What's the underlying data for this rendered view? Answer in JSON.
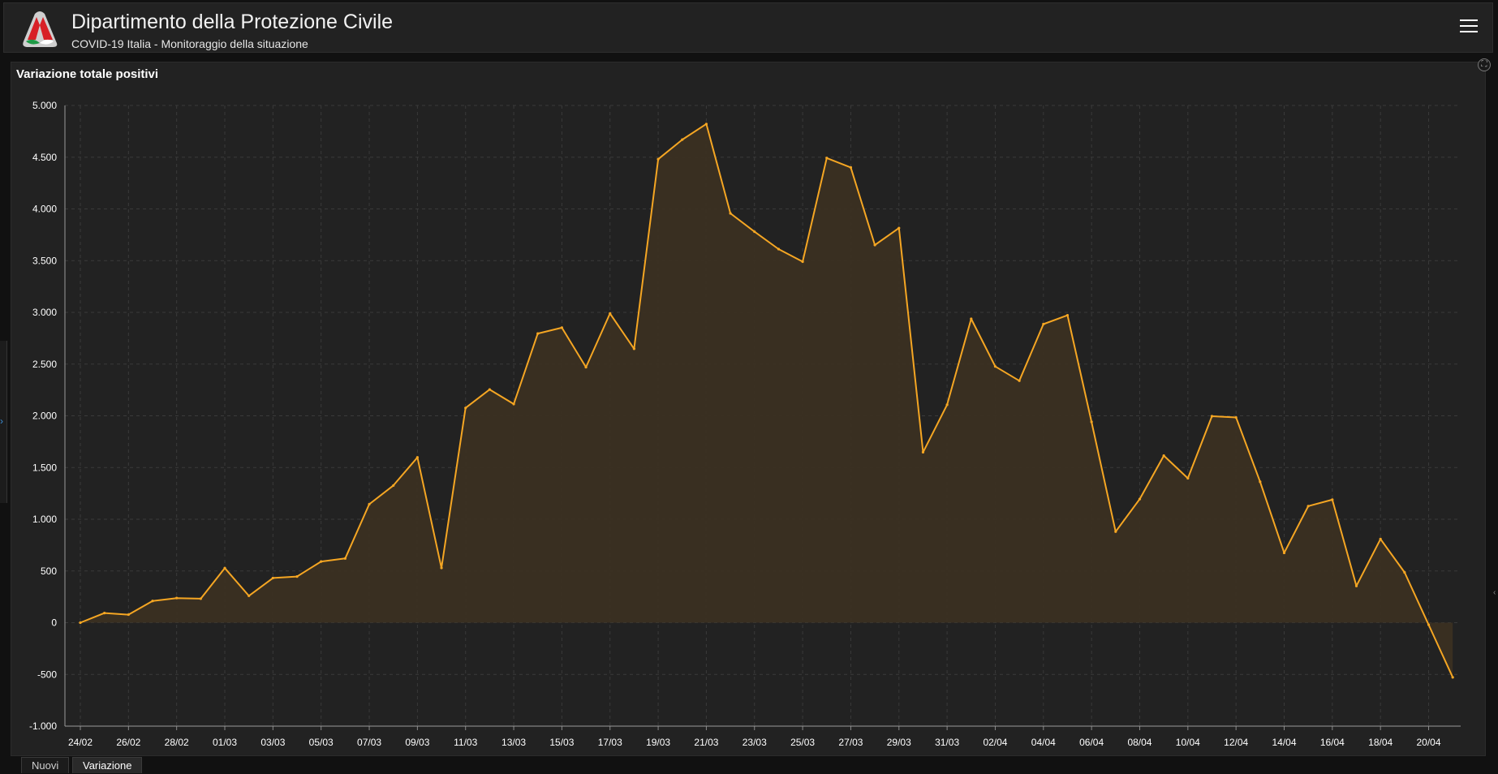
{
  "header": {
    "title": "Dipartimento della Protezione Civile",
    "subtitle": "COVID-19 Italia - Monitoraggio della situazione"
  },
  "panel": {
    "title": "Variazione totale positivi"
  },
  "tabs": [
    "Nuovi",
    "Variazione"
  ],
  "icons": {
    "logo": "protezione-civile-logo",
    "menu": "hamburger-menu-icon",
    "expand": "expand-icon"
  },
  "colors": {
    "line": "#f5a623",
    "area": "#3b3022",
    "background": "#222222",
    "grid": "#3a3a3a"
  },
  "chart_data": {
    "type": "area",
    "title": "Variazione totale positivi",
    "ylim": [
      -1000,
      5000
    ],
    "ytick_values": [
      -1000,
      -500,
      0,
      500,
      1000,
      1500,
      2000,
      2500,
      3000,
      3500,
      4000,
      4500,
      5000
    ],
    "ytick_labels": [
      "-1.000",
      "-500",
      "0",
      "500",
      "1.000",
      "1.500",
      "2.000",
      "2.500",
      "3.000",
      "3.500",
      "4.000",
      "4.500",
      "5.000"
    ],
    "xtick_labels": [
      "24/02",
      "26/02",
      "28/02",
      "01/03",
      "03/03",
      "05/03",
      "07/03",
      "09/03",
      "11/03",
      "13/03",
      "15/03",
      "17/03",
      "19/03",
      "21/03",
      "23/03",
      "25/03",
      "27/03",
      "29/03",
      "31/03",
      "02/04",
      "04/04",
      "06/04",
      "08/04",
      "10/04",
      "12/04",
      "14/04",
      "16/04",
      "18/04",
      "20/04"
    ],
    "grid": true,
    "series": [
      {
        "x": [
          "24/02",
          "25/02",
          "26/02",
          "27/02",
          "28/02",
          "29/02",
          "01/03",
          "02/03",
          "03/03",
          "04/03",
          "05/03",
          "06/03",
          "07/03",
          "08/03",
          "09/03",
          "10/03",
          "11/03",
          "12/03",
          "13/03",
          "14/03",
          "15/03",
          "16/03",
          "17/03",
          "18/03",
          "19/03",
          "20/03",
          "21/03",
          "22/03",
          "23/03",
          "24/03",
          "25/03",
          "26/03",
          "27/03",
          "28/03",
          "29/03",
          "30/03",
          "31/03",
          "01/04",
          "02/04",
          "03/04",
          "04/04",
          "05/04",
          "06/04",
          "07/04",
          "08/04",
          "09/04",
          "10/04",
          "11/04",
          "12/04",
          "13/04",
          "14/04",
          "15/04",
          "16/04",
          "17/04",
          "18/04",
          "19/04",
          "20/04",
          "21/04"
        ],
        "values": [
          0,
          93,
          78,
          210,
          238,
          232,
          528,
          260,
          432,
          446,
          591,
          621,
          1145,
          1326,
          1598,
          529,
          2076,
          2254,
          2114,
          2795,
          2852,
          2470,
          2989,
          2648,
          4481,
          4670,
          4821,
          3957,
          3780,
          3612,
          3490,
          4492,
          4401,
          3651,
          3815,
          1648,
          2107,
          2937,
          2477,
          2339,
          2886,
          2972,
          1941,
          880,
          1195,
          1615,
          1396,
          1996,
          1984,
          1363,
          675,
          1127,
          1189,
          355,
          809,
          486,
          -20,
          -528
        ]
      }
    ]
  }
}
